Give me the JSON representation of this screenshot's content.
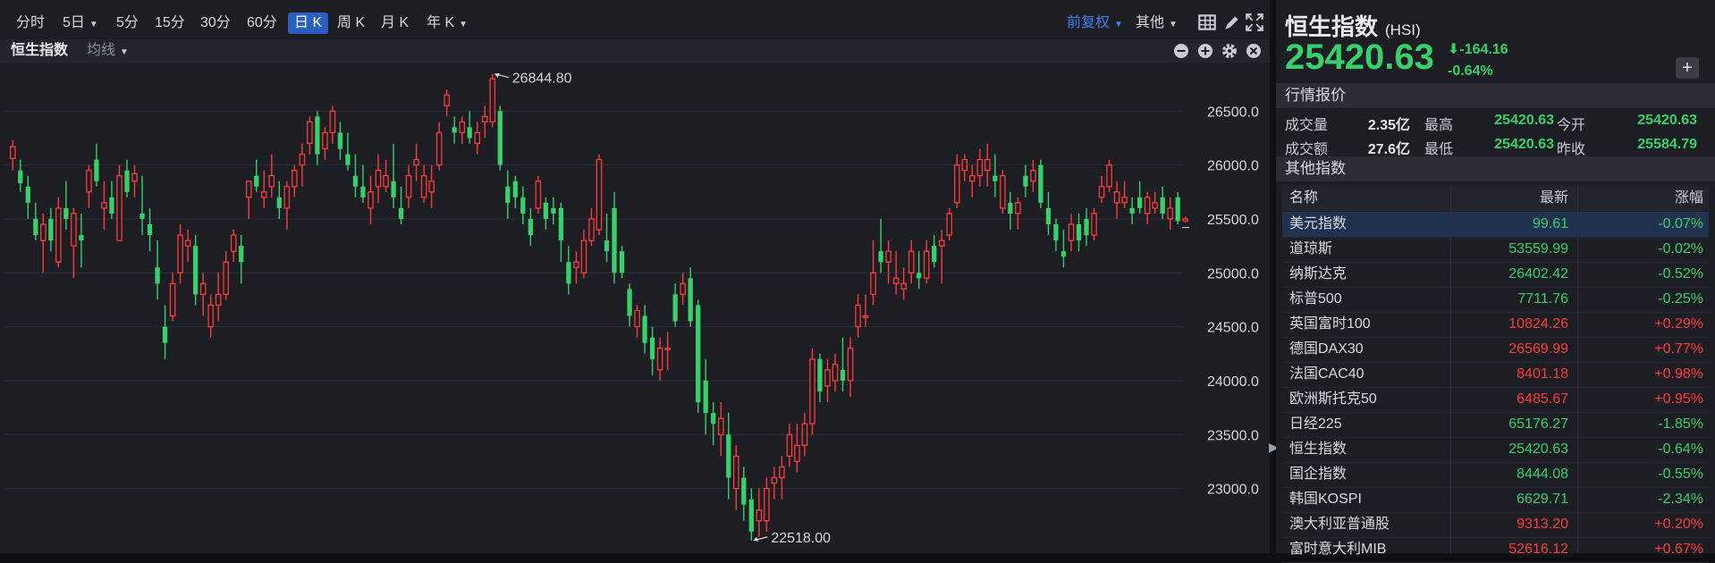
{
  "toolbar": {
    "items": [
      {
        "label": "分时",
        "dropdown": false,
        "active": false
      },
      {
        "label": "5日",
        "dropdown": true,
        "active": false
      },
      {
        "label": "5分",
        "dropdown": false,
        "active": false
      },
      {
        "label": "15分",
        "dropdown": false,
        "active": false
      },
      {
        "label": "30分",
        "dropdown": false,
        "active": false
      },
      {
        "label": "60分",
        "dropdown": false,
        "active": false
      },
      {
        "label": "日 K",
        "dropdown": false,
        "active": true
      },
      {
        "label": "周 K",
        "dropdown": false,
        "active": false
      },
      {
        "label": "月 K",
        "dropdown": false,
        "active": false
      },
      {
        "label": "年 K",
        "dropdown": true,
        "active": false
      }
    ],
    "adjust_label": "前复权",
    "other_label": "其他",
    "icons": [
      "grid-icon",
      "pen-icon",
      "fullscreen-icon"
    ]
  },
  "subbar": {
    "index_name": "恒生指数",
    "ma_label": "均线",
    "icons": [
      "zoom-out-icon",
      "zoom-in-icon",
      "settings-icon",
      "close-icon"
    ]
  },
  "colors": {
    "up": "#ff3a3a",
    "down": "#37d06a",
    "accent": "#3f7ff0",
    "selected_row": "#20324f"
  },
  "chart_data": {
    "type": "candlestick",
    "ylim": [
      22400,
      26950
    ],
    "y_ticks": [
      "26500.0",
      "26000.0",
      "25500.0",
      "25000.0",
      "24500.0",
      "24000.0",
      "23500.0",
      "23000.0"
    ],
    "y_tick_values": [
      26500,
      26000,
      25500,
      25000,
      24500,
      24000,
      23500,
      23000
    ],
    "max_label": "26844.80",
    "min_label": "22518.00",
    "max_value": 26844.8,
    "min_value": 22518,
    "candles": [
      [
        26060,
        26230,
        25950,
        26170
      ],
      [
        25950,
        26050,
        25750,
        25830
      ],
      [
        25800,
        25900,
        25500,
        25650
      ],
      [
        25500,
        25650,
        25300,
        25350
      ],
      [
        25300,
        25550,
        25000,
        25450
      ],
      [
        25500,
        25600,
        25200,
        25300
      ],
      [
        25100,
        25700,
        25050,
        25600
      ],
      [
        25600,
        25850,
        25400,
        25500
      ],
      [
        25250,
        25600,
        24950,
        25550
      ],
      [
        25350,
        25550,
        25050,
        25300
      ],
      [
        25750,
        26000,
        25600,
        25950
      ],
      [
        26050,
        26200,
        25800,
        25850
      ],
      [
        25600,
        25850,
        25400,
        25650
      ],
      [
        25700,
        25850,
        25500,
        25550
      ],
      [
        25300,
        26000,
        25300,
        25900
      ],
      [
        25950,
        26050,
        25700,
        25750
      ],
      [
        25850,
        26000,
        25700,
        25920
      ],
      [
        25550,
        25900,
        25350,
        25500
      ],
      [
        25450,
        25600,
        25200,
        25350
      ],
      [
        25050,
        25300,
        24750,
        24900
      ],
      [
        24500,
        24700,
        24200,
        24350
      ],
      [
        24600,
        25000,
        24550,
        24900
      ],
      [
        25000,
        25450,
        24900,
        25350
      ],
      [
        25250,
        25400,
        25100,
        25300
      ],
      [
        25250,
        25350,
        24700,
        24800
      ],
      [
        24800,
        25000,
        24600,
        24900
      ],
      [
        24500,
        24800,
        24400,
        24700
      ],
      [
        24700,
        25000,
        24550,
        24800
      ],
      [
        24800,
        25200,
        24750,
        25100
      ],
      [
        25200,
        25400,
        25100,
        25350
      ],
      [
        25250,
        25350,
        24900,
        25100
      ],
      [
        25700,
        25800,
        25500,
        25850
      ],
      [
        25900,
        26050,
        25750,
        25800
      ],
      [
        25700,
        25950,
        25600,
        25750
      ],
      [
        25800,
        26100,
        25700,
        25900
      ],
      [
        25700,
        25850,
        25500,
        25600
      ],
      [
        25600,
        25850,
        25400,
        25800
      ],
      [
        25800,
        26000,
        25700,
        25950
      ],
      [
        26000,
        26200,
        25800,
        26100
      ],
      [
        26200,
        26450,
        26100,
        26400
      ],
      [
        26450,
        26500,
        26000,
        26100
      ],
      [
        26150,
        26350,
        26050,
        26300
      ],
      [
        26300,
        26550,
        26200,
        26500
      ],
      [
        26300,
        26400,
        26050,
        26150
      ],
      [
        26100,
        26300,
        25950,
        26000
      ],
      [
        25900,
        26100,
        25700,
        25800
      ],
      [
        25800,
        26000,
        25650,
        25700
      ],
      [
        25600,
        25900,
        25450,
        25750
      ],
      [
        25800,
        26100,
        25650,
        25950
      ],
      [
        25800,
        26050,
        25750,
        25900
      ],
      [
        25850,
        26200,
        25600,
        25700
      ],
      [
        25600,
        25800,
        25450,
        25500
      ],
      [
        25700,
        26000,
        25600,
        25900
      ],
      [
        26000,
        26200,
        25850,
        26050
      ],
      [
        25700,
        26000,
        25650,
        25900
      ],
      [
        25750,
        26000,
        25600,
        25850
      ],
      [
        26000,
        26400,
        25950,
        26300
      ],
      [
        26550,
        26700,
        26450,
        26650
      ],
      [
        26350,
        26450,
        26200,
        26300
      ],
      [
        26300,
        26450,
        26200,
        26400
      ],
      [
        26350,
        26500,
        26200,
        26250
      ],
      [
        26200,
        26400,
        26100,
        26300
      ],
      [
        26400,
        26550,
        26250,
        26450
      ],
      [
        26400,
        26844,
        26350,
        26800
      ],
      [
        26500,
        26550,
        25950,
        26000
      ],
      [
        25800,
        25950,
        25500,
        25650
      ],
      [
        25850,
        25900,
        25600,
        25700
      ],
      [
        25700,
        25800,
        25450,
        25550
      ],
      [
        25500,
        25600,
        25250,
        25350
      ],
      [
        25600,
        25900,
        25550,
        25850
      ],
      [
        25650,
        25700,
        25400,
        25500
      ],
      [
        25600,
        25700,
        25450,
        25550
      ],
      [
        25600,
        25650,
        25100,
        25300
      ],
      [
        25100,
        25250,
        24800,
        24900
      ],
      [
        25050,
        25200,
        24900,
        25100
      ],
      [
        25000,
        25400,
        24950,
        25300
      ],
      [
        25300,
        25600,
        25250,
        25500
      ],
      [
        25400,
        26100,
        25350,
        26050
      ],
      [
        25300,
        25550,
        25100,
        25200
      ],
      [
        25600,
        25750,
        24900,
        25000
      ],
      [
        25200,
        25250,
        24950,
        25000
      ],
      [
        24850,
        24900,
        24500,
        24600
      ],
      [
        24500,
        24700,
        24400,
        24650
      ],
      [
        24600,
        24700,
        24250,
        24350
      ],
      [
        24400,
        24500,
        24050,
        24200
      ],
      [
        24100,
        24400,
        24000,
        24300
      ],
      [
        24300,
        24450,
        24100,
        24300
      ],
      [
        24800,
        24900,
        24500,
        24550
      ],
      [
        24800,
        25000,
        24700,
        24900
      ],
      [
        24950,
        25050,
        24500,
        24550
      ],
      [
        24700,
        24750,
        23700,
        23800
      ],
      [
        24000,
        24200,
        23500,
        23700
      ],
      [
        23700,
        23800,
        23400,
        23600
      ],
      [
        23500,
        23800,
        23300,
        23650
      ],
      [
        23500,
        23700,
        22900,
        23100
      ],
      [
        23000,
        23400,
        22800,
        23300
      ],
      [
        23100,
        23200,
        22700,
        22850
      ],
      [
        22900,
        23000,
        22518,
        22600
      ],
      [
        22700,
        23000,
        22550,
        22800
      ],
      [
        22700,
        23100,
        22600,
        23000
      ],
      [
        23050,
        23200,
        22900,
        23100
      ],
      [
        23100,
        23300,
        22900,
        23200
      ],
      [
        23300,
        23600,
        23200,
        23500
      ],
      [
        23250,
        23600,
        23150,
        23400
      ],
      [
        23400,
        23700,
        23300,
        23600
      ],
      [
        23600,
        24300,
        23500,
        24200
      ],
      [
        24200,
        24250,
        23800,
        23900
      ],
      [
        23950,
        24200,
        23800,
        24100
      ],
      [
        24000,
        24250,
        23900,
        24150
      ],
      [
        24100,
        24400,
        23900,
        24000
      ],
      [
        24000,
        24400,
        23850,
        24300
      ],
      [
        24500,
        24800,
        24400,
        24700
      ],
      [
        24600,
        24800,
        24500,
        24600
      ],
      [
        24800,
        25300,
        24700,
        25000
      ],
      [
        25200,
        25500,
        25000,
        25100
      ],
      [
        25100,
        25300,
        24900,
        25200
      ],
      [
        24900,
        25200,
        24800,
        24950
      ],
      [
        24850,
        25050,
        24750,
        24900
      ],
      [
        25000,
        25300,
        24900,
        25200
      ],
      [
        25000,
        25200,
        24850,
        24950
      ],
      [
        24950,
        25300,
        24900,
        25200
      ],
      [
        25250,
        25350,
        25050,
        25100
      ],
      [
        25250,
        25400,
        24900,
        25300
      ],
      [
        25350,
        25600,
        25300,
        25550
      ],
      [
        25650,
        26100,
        25600,
        26000
      ],
      [
        25950,
        26100,
        25850,
        26050
      ],
      [
        25850,
        26000,
        25700,
        25900
      ],
      [
        25900,
        26150,
        25800,
        26050
      ],
      [
        25950,
        26200,
        25800,
        26050
      ],
      [
        25900,
        26100,
        25700,
        25850
      ],
      [
        25600,
        25950,
        25550,
        25900
      ],
      [
        25650,
        25750,
        25400,
        25550
      ],
      [
        25550,
        25700,
        25400,
        25650
      ],
      [
        25900,
        26000,
        25700,
        25800
      ],
      [
        25850,
        26050,
        25750,
        25950
      ],
      [
        26000,
        26050,
        25600,
        25650
      ],
      [
        25600,
        25750,
        25350,
        25450
      ],
      [
        25450,
        25500,
        25200,
        25300
      ],
      [
        25200,
        25400,
        25050,
        25150
      ],
      [
        25300,
        25550,
        25200,
        25450
      ],
      [
        25450,
        25550,
        25200,
        25300
      ],
      [
        25500,
        25600,
        25250,
        25350
      ],
      [
        25350,
        25600,
        25300,
        25550
      ],
      [
        25700,
        25900,
        25650,
        25800
      ],
      [
        25800,
        26050,
        25750,
        26000
      ],
      [
        25650,
        25850,
        25500,
        25750
      ],
      [
        25650,
        25850,
        25600,
        25700
      ],
      [
        25600,
        25700,
        25450,
        25550
      ],
      [
        25700,
        25850,
        25550,
        25600
      ],
      [
        25550,
        25750,
        25450,
        25700
      ],
      [
        25600,
        25750,
        25550,
        25650
      ],
      [
        25700,
        25800,
        25500,
        25550
      ],
      [
        25500,
        25700,
        25400,
        25600
      ],
      [
        25700,
        25750,
        25450,
        25480
      ],
      [
        25480,
        25520,
        25470,
        25500
      ]
    ]
  },
  "quote": {
    "name": "恒生指数",
    "code": "(HSI)",
    "price": "25420.63",
    "change": "-164.16",
    "change_pct": "-0.64%",
    "section_market": "行情报价",
    "stats": [
      {
        "label": "成交量",
        "value": "2.35亿"
      },
      {
        "label": "最高",
        "value": "25420.63"
      },
      {
        "label": "今开",
        "value": "25420.63"
      },
      {
        "label": "成交额",
        "value": "27.6亿"
      },
      {
        "label": "最低",
        "value": "25420.63"
      },
      {
        "label": "昨收",
        "value": "25584.79"
      }
    ],
    "section_other": "其他指数",
    "add_label": "+"
  },
  "index_table": {
    "headers": [
      "名称",
      "最新",
      "涨幅"
    ],
    "rows": [
      {
        "name": "美元指数",
        "price": "99.61",
        "chg": "-0.07%",
        "up": false
      },
      {
        "name": "道琼斯",
        "price": "53559.99",
        "chg": "-0.02%",
        "up": false
      },
      {
        "name": "纳斯达克",
        "price": "26402.42",
        "chg": "-0.52%",
        "up": false
      },
      {
        "name": "标普500",
        "price": "7711.76",
        "chg": "-0.25%",
        "up": false
      },
      {
        "name": "英国富时100",
        "price": "10824.26",
        "chg": "+0.29%",
        "up": true
      },
      {
        "name": "德国DAX30",
        "price": "26569.99",
        "chg": "+0.77%",
        "up": true
      },
      {
        "name": "法国CAC40",
        "price": "8401.18",
        "chg": "+0.98%",
        "up": true
      },
      {
        "name": "欧洲斯托克50",
        "price": "6485.67",
        "chg": "+0.95%",
        "up": true
      },
      {
        "name": "日经225",
        "price": "65176.27",
        "chg": "-1.85%",
        "up": false
      },
      {
        "name": "恒生指数",
        "price": "25420.63",
        "chg": "-0.64%",
        "up": false
      },
      {
        "name": "国企指数",
        "price": "8444.08",
        "chg": "-0.55%",
        "up": false
      },
      {
        "name": "韩国KOSPI",
        "price": "6629.71",
        "chg": "-2.34%",
        "up": false
      },
      {
        "name": "澳大利亚普通股",
        "price": "9313.20",
        "chg": "+0.20%",
        "up": true
      },
      {
        "name": "富时意大利MIB",
        "price": "52616.12",
        "chg": "+0.67%",
        "up": true
      }
    ]
  }
}
